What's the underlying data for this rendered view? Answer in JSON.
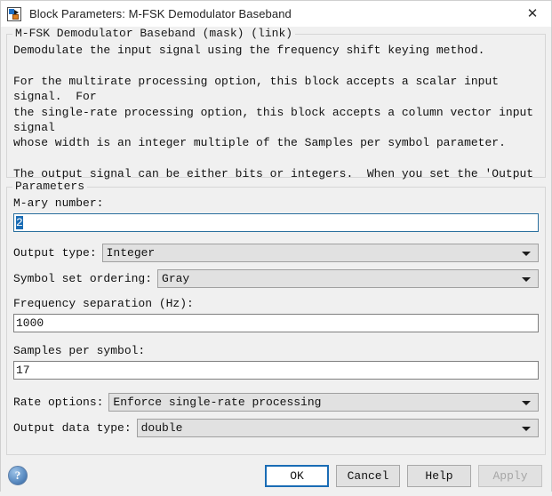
{
  "window": {
    "title": "Block Parameters: M-FSK Demodulator Baseband",
    "icon": "simulink-block-icon",
    "close_label": "✕"
  },
  "description": {
    "legend": "M-FSK Demodulator Baseband (mask) (link)",
    "text": "Demodulate the input signal using the frequency shift keying method.\n\nFor the multirate processing option, this block accepts a scalar input signal.  For\nthe single-rate processing option, this block accepts a column vector input signal\nwhose width is an integer multiple of the Samples per symbol parameter.\n\nThe output signal can be either bits or integers.  When you set the 'Output type'\nparameter to 'Bit', the output width is an integer multiple of the number of bits per\nsymbol."
  },
  "parameters": {
    "legend": "Parameters",
    "m_ary_number": {
      "label": "M-ary number:",
      "value": "2",
      "selected": true
    },
    "output_type": {
      "label": "Output type:",
      "value": "Integer"
    },
    "symbol_set_ordering": {
      "label": "Symbol set ordering:",
      "value": "Gray"
    },
    "frequency_separation": {
      "label": "Frequency separation (Hz):",
      "value": "1000"
    },
    "samples_per_symbol": {
      "label": "Samples per symbol:",
      "value": "17"
    },
    "rate_options": {
      "label": "Rate options:",
      "value": "Enforce single-rate processing"
    },
    "output_data_type": {
      "label": "Output data type:",
      "value": "double"
    }
  },
  "footer": {
    "help_icon_glyph": "?",
    "ok_label": "OK",
    "cancel_label": "Cancel",
    "help_label": "Help",
    "apply_label": "Apply"
  },
  "colors": {
    "accent": "#1a6cb5",
    "dialog_bg": "#f0f0f0",
    "field_bg": "#ffffff",
    "combo_bg": "#e1e1e1"
  }
}
